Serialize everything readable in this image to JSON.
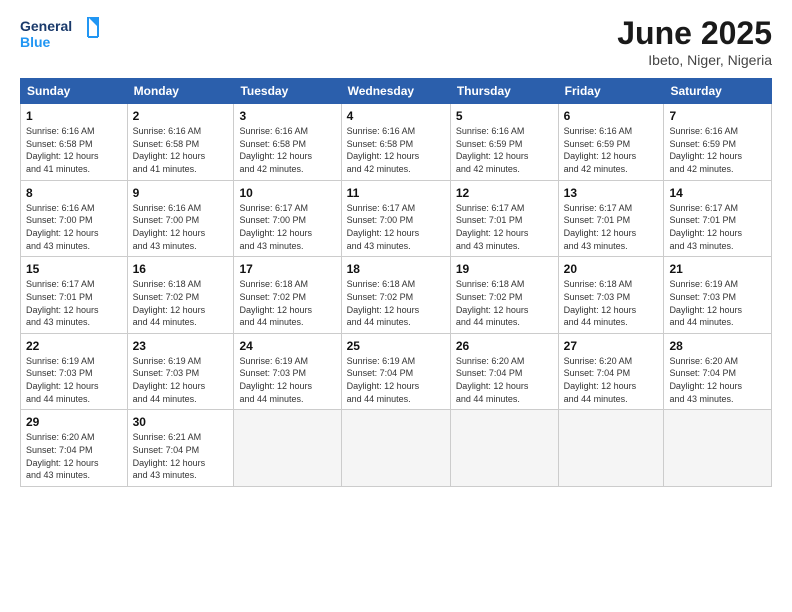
{
  "logo": {
    "text_general": "General",
    "text_blue": "Blue"
  },
  "header": {
    "title": "June 2025",
    "subtitle": "Ibeto, Niger, Nigeria"
  },
  "days_of_week": [
    "Sunday",
    "Monday",
    "Tuesday",
    "Wednesday",
    "Thursday",
    "Friday",
    "Saturday"
  ],
  "weeks": [
    [
      {
        "day": "1",
        "info": "Sunrise: 6:16 AM\nSunset: 6:58 PM\nDaylight: 12 hours\nand 41 minutes."
      },
      {
        "day": "2",
        "info": "Sunrise: 6:16 AM\nSunset: 6:58 PM\nDaylight: 12 hours\nand 41 minutes."
      },
      {
        "day": "3",
        "info": "Sunrise: 6:16 AM\nSunset: 6:58 PM\nDaylight: 12 hours\nand 42 minutes."
      },
      {
        "day": "4",
        "info": "Sunrise: 6:16 AM\nSunset: 6:58 PM\nDaylight: 12 hours\nand 42 minutes."
      },
      {
        "day": "5",
        "info": "Sunrise: 6:16 AM\nSunset: 6:59 PM\nDaylight: 12 hours\nand 42 minutes."
      },
      {
        "day": "6",
        "info": "Sunrise: 6:16 AM\nSunset: 6:59 PM\nDaylight: 12 hours\nand 42 minutes."
      },
      {
        "day": "7",
        "info": "Sunrise: 6:16 AM\nSunset: 6:59 PM\nDaylight: 12 hours\nand 42 minutes."
      }
    ],
    [
      {
        "day": "8",
        "info": "Sunrise: 6:16 AM\nSunset: 7:00 PM\nDaylight: 12 hours\nand 43 minutes."
      },
      {
        "day": "9",
        "info": "Sunrise: 6:16 AM\nSunset: 7:00 PM\nDaylight: 12 hours\nand 43 minutes."
      },
      {
        "day": "10",
        "info": "Sunrise: 6:17 AM\nSunset: 7:00 PM\nDaylight: 12 hours\nand 43 minutes."
      },
      {
        "day": "11",
        "info": "Sunrise: 6:17 AM\nSunset: 7:00 PM\nDaylight: 12 hours\nand 43 minutes."
      },
      {
        "day": "12",
        "info": "Sunrise: 6:17 AM\nSunset: 7:01 PM\nDaylight: 12 hours\nand 43 minutes."
      },
      {
        "day": "13",
        "info": "Sunrise: 6:17 AM\nSunset: 7:01 PM\nDaylight: 12 hours\nand 43 minutes."
      },
      {
        "day": "14",
        "info": "Sunrise: 6:17 AM\nSunset: 7:01 PM\nDaylight: 12 hours\nand 43 minutes."
      }
    ],
    [
      {
        "day": "15",
        "info": "Sunrise: 6:17 AM\nSunset: 7:01 PM\nDaylight: 12 hours\nand 43 minutes."
      },
      {
        "day": "16",
        "info": "Sunrise: 6:18 AM\nSunset: 7:02 PM\nDaylight: 12 hours\nand 44 minutes."
      },
      {
        "day": "17",
        "info": "Sunrise: 6:18 AM\nSunset: 7:02 PM\nDaylight: 12 hours\nand 44 minutes."
      },
      {
        "day": "18",
        "info": "Sunrise: 6:18 AM\nSunset: 7:02 PM\nDaylight: 12 hours\nand 44 minutes."
      },
      {
        "day": "19",
        "info": "Sunrise: 6:18 AM\nSunset: 7:02 PM\nDaylight: 12 hours\nand 44 minutes."
      },
      {
        "day": "20",
        "info": "Sunrise: 6:18 AM\nSunset: 7:03 PM\nDaylight: 12 hours\nand 44 minutes."
      },
      {
        "day": "21",
        "info": "Sunrise: 6:19 AM\nSunset: 7:03 PM\nDaylight: 12 hours\nand 44 minutes."
      }
    ],
    [
      {
        "day": "22",
        "info": "Sunrise: 6:19 AM\nSunset: 7:03 PM\nDaylight: 12 hours\nand 44 minutes."
      },
      {
        "day": "23",
        "info": "Sunrise: 6:19 AM\nSunset: 7:03 PM\nDaylight: 12 hours\nand 44 minutes."
      },
      {
        "day": "24",
        "info": "Sunrise: 6:19 AM\nSunset: 7:03 PM\nDaylight: 12 hours\nand 44 minutes."
      },
      {
        "day": "25",
        "info": "Sunrise: 6:19 AM\nSunset: 7:04 PM\nDaylight: 12 hours\nand 44 minutes."
      },
      {
        "day": "26",
        "info": "Sunrise: 6:20 AM\nSunset: 7:04 PM\nDaylight: 12 hours\nand 44 minutes."
      },
      {
        "day": "27",
        "info": "Sunrise: 6:20 AM\nSunset: 7:04 PM\nDaylight: 12 hours\nand 44 minutes."
      },
      {
        "day": "28",
        "info": "Sunrise: 6:20 AM\nSunset: 7:04 PM\nDaylight: 12 hours\nand 43 minutes."
      }
    ],
    [
      {
        "day": "29",
        "info": "Sunrise: 6:20 AM\nSunset: 7:04 PM\nDaylight: 12 hours\nand 43 minutes."
      },
      {
        "day": "30",
        "info": "Sunrise: 6:21 AM\nSunset: 7:04 PM\nDaylight: 12 hours\nand 43 minutes."
      },
      {
        "day": "",
        "info": ""
      },
      {
        "day": "",
        "info": ""
      },
      {
        "day": "",
        "info": ""
      },
      {
        "day": "",
        "info": ""
      },
      {
        "day": "",
        "info": ""
      }
    ]
  ]
}
